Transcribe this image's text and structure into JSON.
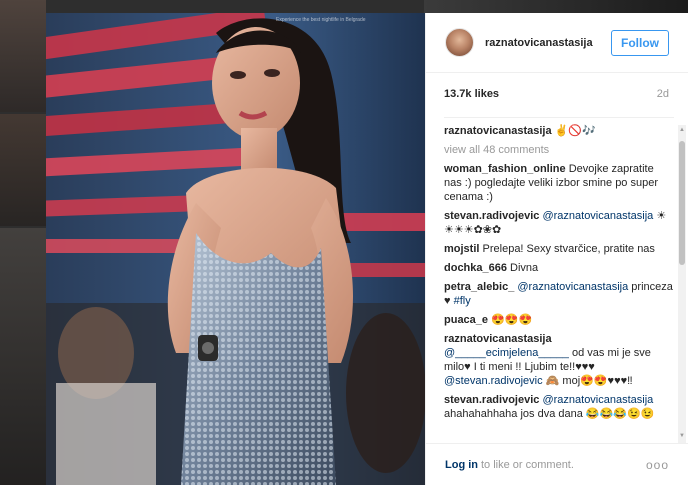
{
  "post": {
    "username": "raznatovicanastasija",
    "follow_label": "Follow",
    "likes": "13.7k likes",
    "age": "2d",
    "caption_user": "raznatovicanastasija",
    "caption_text": "✌🚫🎶",
    "view_all": "view all 48 comments",
    "photo_overlay_text": "Experience the best nightlife in Belgrade"
  },
  "comments": [
    {
      "user": "woman_fashion_online",
      "text": "Devojke zapratite nas :) pogledajte veliki izbor smine po super cenama :)"
    },
    {
      "user": "stevan.radivojevic",
      "mention": "@raznatovicanastasija",
      "text": "☀☀☀☀✿❀✿"
    },
    {
      "user": "mojstil",
      "text": "Prelepa! Sexy stvarčice, pratite nas"
    },
    {
      "user": "dochka_666",
      "text": "Divna"
    },
    {
      "user": "petra_alebic_",
      "mention": "@raznatovicanastasija",
      "text": "princeza ♥",
      "tag": "#fly"
    },
    {
      "user": "puaca_e",
      "text": "😍😍😍"
    },
    {
      "user": "raznatovicanastasija",
      "mention": "@_____ecimjelena_____",
      "text": "od vas mi je sve milo♥ I ti meni !! Ljubim te!!♥♥♥",
      "mention2": "@stevan.radivojevic",
      "text2": "🙈 moj😍😍♥♥♥‼"
    },
    {
      "user": "stevan.radivojevic",
      "mention": "@raznatovicanastasija",
      "text": "ahahahahhaha jos dva dana 😂😂😂😉😉"
    }
  ],
  "footer": {
    "login_label": "Log in",
    "rest": "to like or comment.",
    "more": "ooo"
  },
  "colors": {
    "accent": "#3897f0",
    "link": "#003569",
    "muted": "#999999"
  }
}
